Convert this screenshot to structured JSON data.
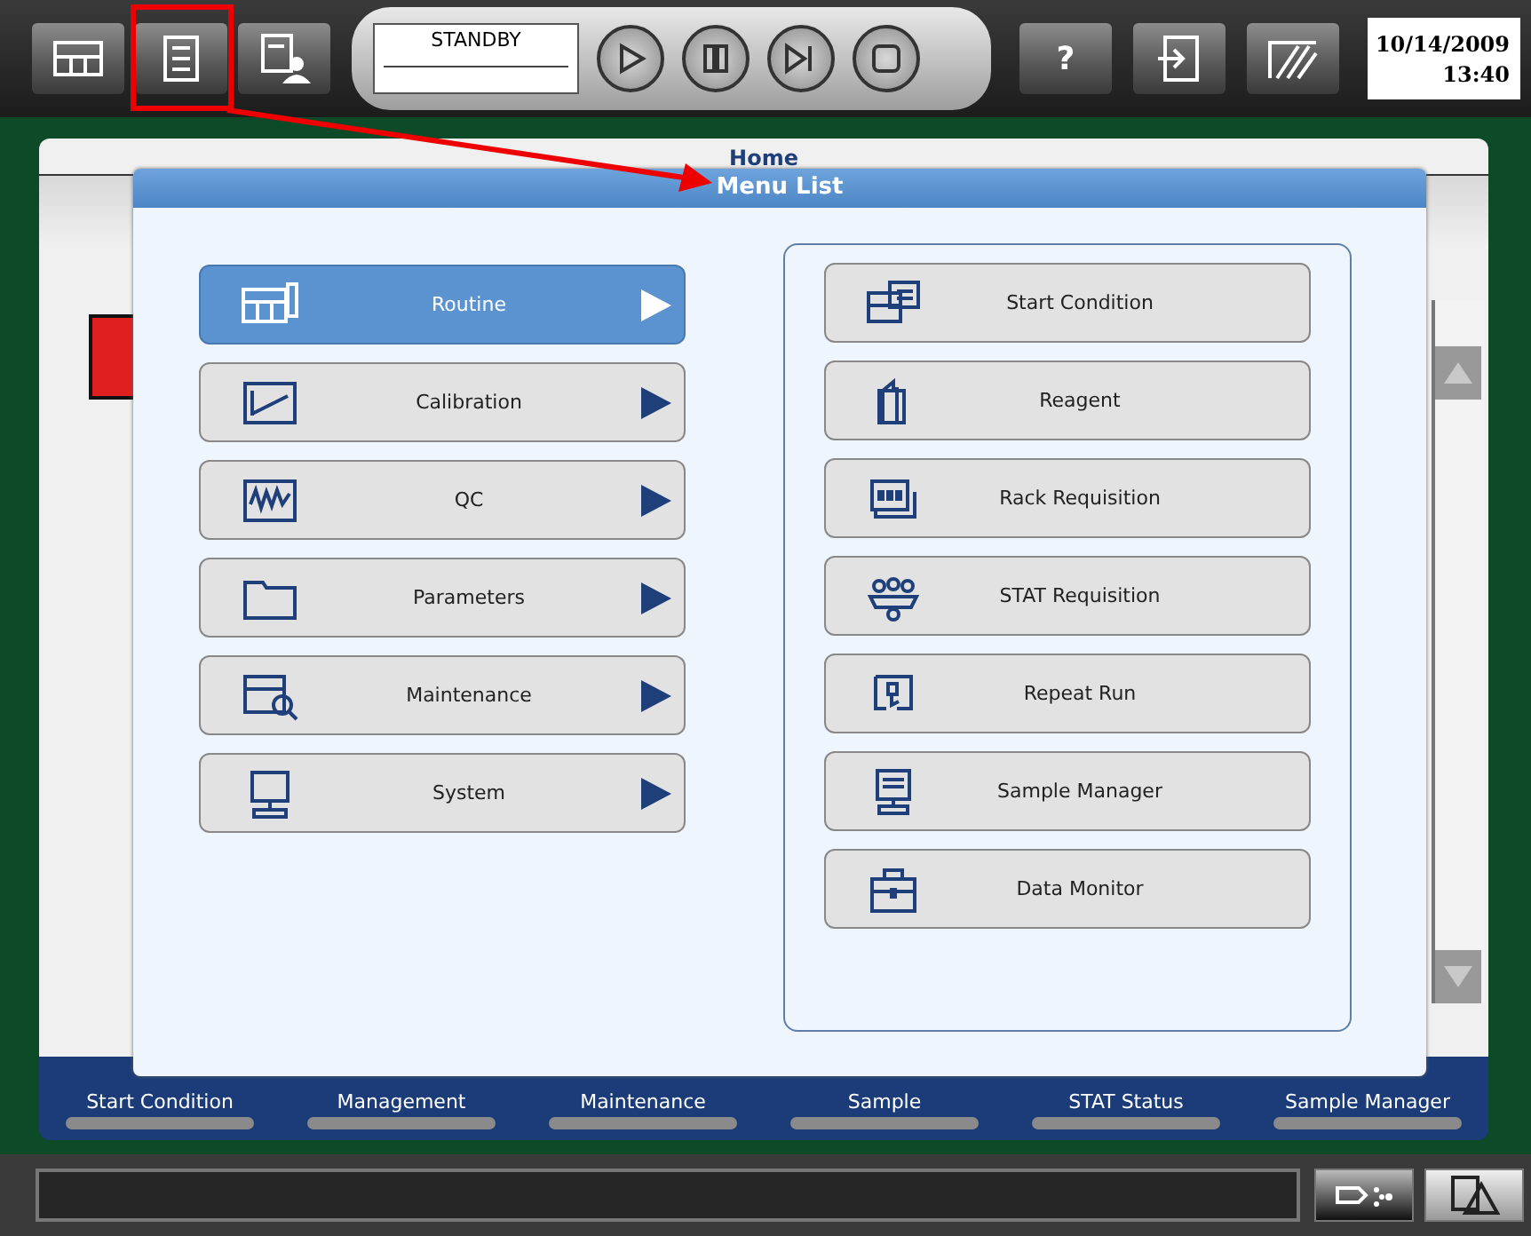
{
  "toolbar": {
    "status": "STANDBY",
    "help": "?",
    "date": "10/14/2009",
    "time": "13:40"
  },
  "home": {
    "title": "Home"
  },
  "menu_dialog": {
    "title": "Menu List",
    "left_items": [
      {
        "label": "Routine",
        "selected": true
      },
      {
        "label": "Calibration",
        "selected": false
      },
      {
        "label": "QC",
        "selected": false
      },
      {
        "label": "Parameters",
        "selected": false
      },
      {
        "label": "Maintenance",
        "selected": false
      },
      {
        "label": "System",
        "selected": false
      }
    ],
    "right_items": [
      {
        "label": "Start Condition"
      },
      {
        "label": "Reagent"
      },
      {
        "label": "Rack Requisition"
      },
      {
        "label": "STAT Requisition"
      },
      {
        "label": "Repeat Run"
      },
      {
        "label": "Sample Manager"
      },
      {
        "label": "Data Monitor"
      }
    ]
  },
  "bottom_nav": [
    {
      "label": "Start Condition"
    },
    {
      "label": "Management"
    },
    {
      "label": "Maintenance"
    },
    {
      "label": "Sample"
    },
    {
      "label": "STAT Status"
    },
    {
      "label": "Sample Manager"
    }
  ]
}
